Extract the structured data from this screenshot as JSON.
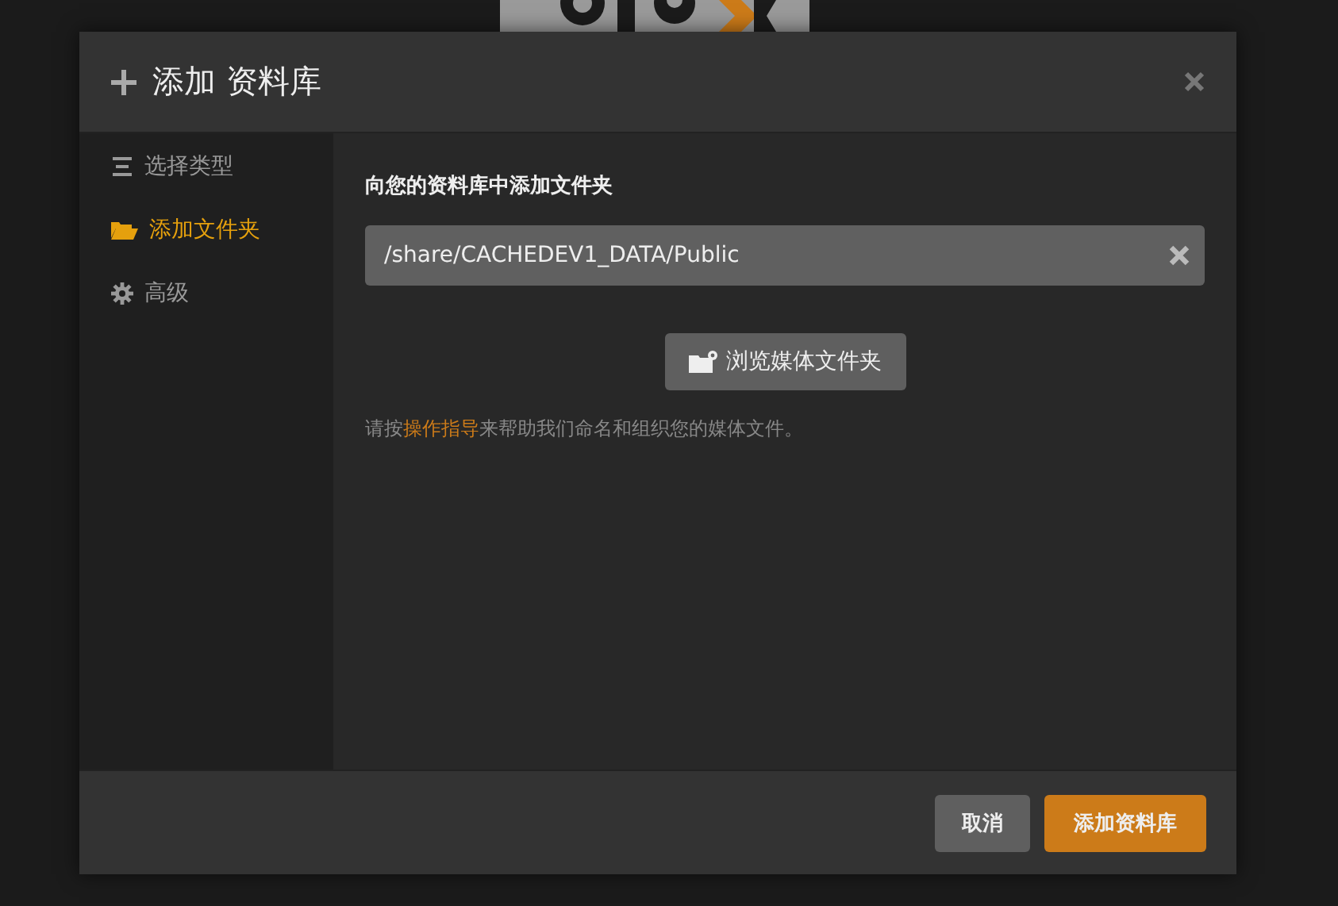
{
  "dialog": {
    "title": "添加 资料库",
    "sidebar": {
      "items": [
        {
          "label": "选择类型",
          "kind": "list",
          "selected": false
        },
        {
          "label": "添加文件夹",
          "kind": "folder",
          "selected": true
        },
        {
          "label": "高级",
          "kind": "gear",
          "selected": false
        }
      ]
    },
    "content": {
      "heading": "向您的资料库中添加文件夹",
      "folder_field": {
        "value": "/share/CACHEDEV1_DATA/Public"
      },
      "browse_button": "浏览媒体文件夹",
      "help": {
        "before": "请按",
        "link": "操作指导",
        "after": "来帮助我们命名和组织您的媒体文件。"
      }
    },
    "buttons": [
      {
        "label": "取消",
        "kind": "secondary"
      },
      {
        "label": "添加资料库",
        "kind": "primary"
      }
    ]
  }
}
